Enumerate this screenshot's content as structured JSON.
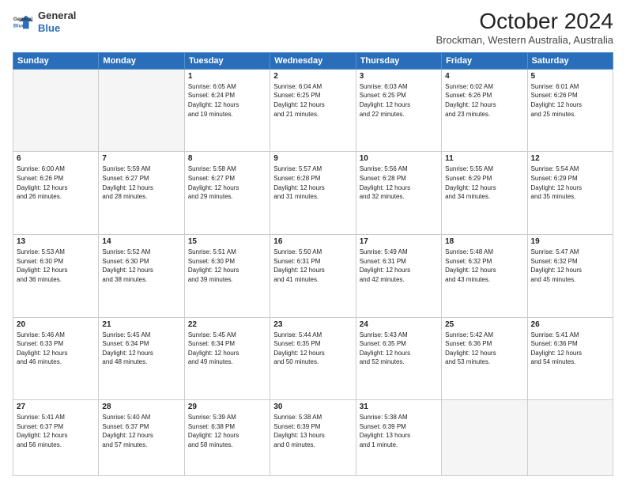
{
  "logo": {
    "line1": "General",
    "line2": "Blue"
  },
  "title": "October 2024",
  "subtitle": "Brockman, Western Australia, Australia",
  "headers": [
    "Sunday",
    "Monday",
    "Tuesday",
    "Wednesday",
    "Thursday",
    "Friday",
    "Saturday"
  ],
  "weeks": [
    [
      {
        "day": "",
        "text": ""
      },
      {
        "day": "",
        "text": ""
      },
      {
        "day": "1",
        "text": "Sunrise: 6:05 AM\nSunset: 6:24 PM\nDaylight: 12 hours\nand 19 minutes."
      },
      {
        "day": "2",
        "text": "Sunrise: 6:04 AM\nSunset: 6:25 PM\nDaylight: 12 hours\nand 21 minutes."
      },
      {
        "day": "3",
        "text": "Sunrise: 6:03 AM\nSunset: 6:25 PM\nDaylight: 12 hours\nand 22 minutes."
      },
      {
        "day": "4",
        "text": "Sunrise: 6:02 AM\nSunset: 6:26 PM\nDaylight: 12 hours\nand 23 minutes."
      },
      {
        "day": "5",
        "text": "Sunrise: 6:01 AM\nSunset: 6:26 PM\nDaylight: 12 hours\nand 25 minutes."
      }
    ],
    [
      {
        "day": "6",
        "text": "Sunrise: 6:00 AM\nSunset: 6:26 PM\nDaylight: 12 hours\nand 26 minutes."
      },
      {
        "day": "7",
        "text": "Sunrise: 5:59 AM\nSunset: 6:27 PM\nDaylight: 12 hours\nand 28 minutes."
      },
      {
        "day": "8",
        "text": "Sunrise: 5:58 AM\nSunset: 6:27 PM\nDaylight: 12 hours\nand 29 minutes."
      },
      {
        "day": "9",
        "text": "Sunrise: 5:57 AM\nSunset: 6:28 PM\nDaylight: 12 hours\nand 31 minutes."
      },
      {
        "day": "10",
        "text": "Sunrise: 5:56 AM\nSunset: 6:28 PM\nDaylight: 12 hours\nand 32 minutes."
      },
      {
        "day": "11",
        "text": "Sunrise: 5:55 AM\nSunset: 6:29 PM\nDaylight: 12 hours\nand 34 minutes."
      },
      {
        "day": "12",
        "text": "Sunrise: 5:54 AM\nSunset: 6:29 PM\nDaylight: 12 hours\nand 35 minutes."
      }
    ],
    [
      {
        "day": "13",
        "text": "Sunrise: 5:53 AM\nSunset: 6:30 PM\nDaylight: 12 hours\nand 36 minutes."
      },
      {
        "day": "14",
        "text": "Sunrise: 5:52 AM\nSunset: 6:30 PM\nDaylight: 12 hours\nand 38 minutes."
      },
      {
        "day": "15",
        "text": "Sunrise: 5:51 AM\nSunset: 6:30 PM\nDaylight: 12 hours\nand 39 minutes."
      },
      {
        "day": "16",
        "text": "Sunrise: 5:50 AM\nSunset: 6:31 PM\nDaylight: 12 hours\nand 41 minutes."
      },
      {
        "day": "17",
        "text": "Sunrise: 5:49 AM\nSunset: 6:31 PM\nDaylight: 12 hours\nand 42 minutes."
      },
      {
        "day": "18",
        "text": "Sunrise: 5:48 AM\nSunset: 6:32 PM\nDaylight: 12 hours\nand 43 minutes."
      },
      {
        "day": "19",
        "text": "Sunrise: 5:47 AM\nSunset: 6:32 PM\nDaylight: 12 hours\nand 45 minutes."
      }
    ],
    [
      {
        "day": "20",
        "text": "Sunrise: 5:46 AM\nSunset: 6:33 PM\nDaylight: 12 hours\nand 46 minutes."
      },
      {
        "day": "21",
        "text": "Sunrise: 5:45 AM\nSunset: 6:34 PM\nDaylight: 12 hours\nand 48 minutes."
      },
      {
        "day": "22",
        "text": "Sunrise: 5:45 AM\nSunset: 6:34 PM\nDaylight: 12 hours\nand 49 minutes."
      },
      {
        "day": "23",
        "text": "Sunrise: 5:44 AM\nSunset: 6:35 PM\nDaylight: 12 hours\nand 50 minutes."
      },
      {
        "day": "24",
        "text": "Sunrise: 5:43 AM\nSunset: 6:35 PM\nDaylight: 12 hours\nand 52 minutes."
      },
      {
        "day": "25",
        "text": "Sunrise: 5:42 AM\nSunset: 6:36 PM\nDaylight: 12 hours\nand 53 minutes."
      },
      {
        "day": "26",
        "text": "Sunrise: 5:41 AM\nSunset: 6:36 PM\nDaylight: 12 hours\nand 54 minutes."
      }
    ],
    [
      {
        "day": "27",
        "text": "Sunrise: 5:41 AM\nSunset: 6:37 PM\nDaylight: 12 hours\nand 56 minutes."
      },
      {
        "day": "28",
        "text": "Sunrise: 5:40 AM\nSunset: 6:37 PM\nDaylight: 12 hours\nand 57 minutes."
      },
      {
        "day": "29",
        "text": "Sunrise: 5:39 AM\nSunset: 6:38 PM\nDaylight: 12 hours\nand 58 minutes."
      },
      {
        "day": "30",
        "text": "Sunrise: 5:38 AM\nSunset: 6:39 PM\nDaylight: 13 hours\nand 0 minutes."
      },
      {
        "day": "31",
        "text": "Sunrise: 5:38 AM\nSunset: 6:39 PM\nDaylight: 13 hours\nand 1 minute."
      },
      {
        "day": "",
        "text": ""
      },
      {
        "day": "",
        "text": ""
      }
    ]
  ]
}
